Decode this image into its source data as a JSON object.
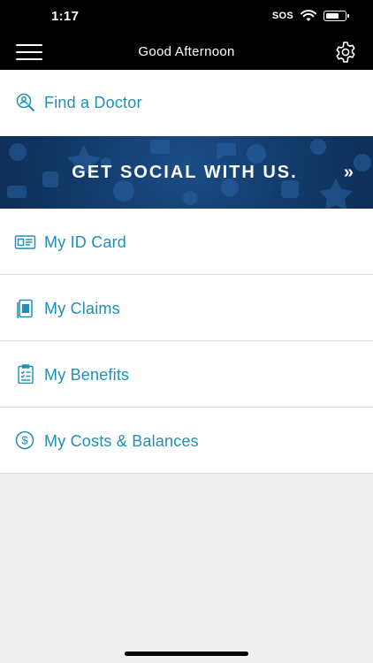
{
  "status": {
    "time": "1:17",
    "sos": "SOS"
  },
  "header": {
    "title": "Good Afternoon"
  },
  "find_doctor": {
    "label": "Find a Doctor"
  },
  "banner": {
    "text": "GET SOCIAL WITH US.",
    "arrow": "»"
  },
  "menu": [
    {
      "label": "My ID Card",
      "icon": "id-card-icon"
    },
    {
      "label": "My Claims",
      "icon": "claims-document-icon"
    },
    {
      "label": "My Benefits",
      "icon": "clipboard-checklist-icon"
    },
    {
      "label": "My Costs & Balances",
      "icon": "dollar-circle-icon"
    }
  ],
  "colors": {
    "accent": "#1f8fb8",
    "banner": "#123a6b",
    "bar": "#000000",
    "background": "#efefef"
  }
}
